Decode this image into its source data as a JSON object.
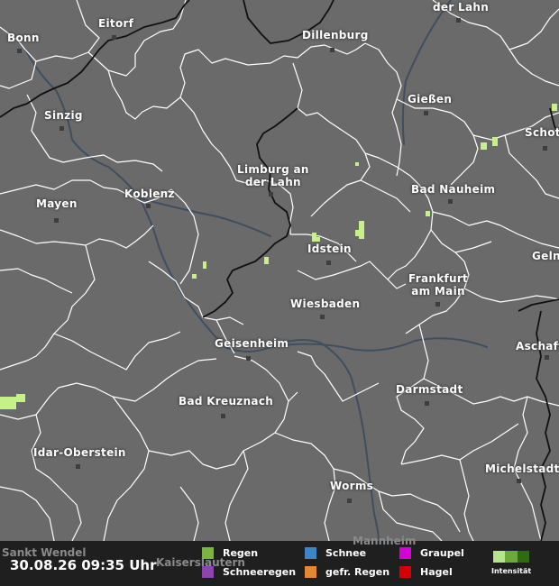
{
  "cities": [
    {
      "name": "Bonn",
      "lines": [
        "Bonn"
      ]
    },
    {
      "name": "Eitorf",
      "lines": [
        "Eitorf"
      ]
    },
    {
      "name": "der Lahn",
      "lines": [
        "der Lahn"
      ]
    },
    {
      "name": "Dillenburg",
      "lines": [
        "Dillenburg"
      ]
    },
    {
      "name": "Sinzig",
      "lines": [
        "Sinzig"
      ]
    },
    {
      "name": "Gießen",
      "lines": [
        "Gießen"
      ]
    },
    {
      "name": "Schot",
      "lines": [
        "Schot"
      ]
    },
    {
      "name": "Limburg an der Lahn",
      "lines": [
        "Limburg an",
        "der Lahn"
      ]
    },
    {
      "name": "Koblenz",
      "lines": [
        "Koblenz"
      ]
    },
    {
      "name": "Bad Nauheim",
      "lines": [
        "Bad Nauheim"
      ]
    },
    {
      "name": "Mayen",
      "lines": [
        "Mayen"
      ]
    },
    {
      "name": "Idstein",
      "lines": [
        "Idstein"
      ]
    },
    {
      "name": "Geln",
      "lines": [
        "Geln"
      ]
    },
    {
      "name": "Frankfurt am Main",
      "lines": [
        "Frankfurt",
        "am Main"
      ]
    },
    {
      "name": "Wiesbaden",
      "lines": [
        "Wiesbaden"
      ]
    },
    {
      "name": "Geisenheim",
      "lines": [
        "Geisenheim"
      ]
    },
    {
      "name": "Aschaff",
      "lines": [
        "Aschaff"
      ]
    },
    {
      "name": "Bad Kreuznach",
      "lines": [
        "Bad Kreuznach"
      ]
    },
    {
      "name": "Darmstadt",
      "lines": [
        "Darmstadt"
      ]
    },
    {
      "name": "Idar-Oberstein",
      "lines": [
        "Idar-Oberstein"
      ]
    },
    {
      "name": "Michelstadt",
      "lines": [
        "Michelstadt"
      ]
    },
    {
      "name": "Worms",
      "lines": [
        "Worms"
      ]
    }
  ],
  "under_legend_labels": [
    "Sankt Wendel",
    "Kaiserslautern",
    "Mannheim"
  ],
  "timestamp": "30.08.26 09:35 Uhr",
  "legend": [
    {
      "label": "Regen",
      "color": "#7cb342"
    },
    {
      "label": "Schneeregen",
      "color": "#8e44ad"
    },
    {
      "label": "Schnee",
      "color": "#3d85c6"
    },
    {
      "label": "gefr. Regen",
      "color": "#e08a33"
    },
    {
      "label": "Graupel",
      "color": "#d500d5"
    },
    {
      "label": "Hagel",
      "color": "#d50000"
    }
  ],
  "intensity_label": "Intensität",
  "intensity_colors": [
    "#b5e58a",
    "#6aaa3a",
    "#2e6b12"
  ],
  "map_colors": {
    "land": "#6a6a6a",
    "borders": "#ffffff",
    "state_border": "#000000",
    "rivers": "#3f4f5f",
    "precip": "#c6f08a"
  }
}
